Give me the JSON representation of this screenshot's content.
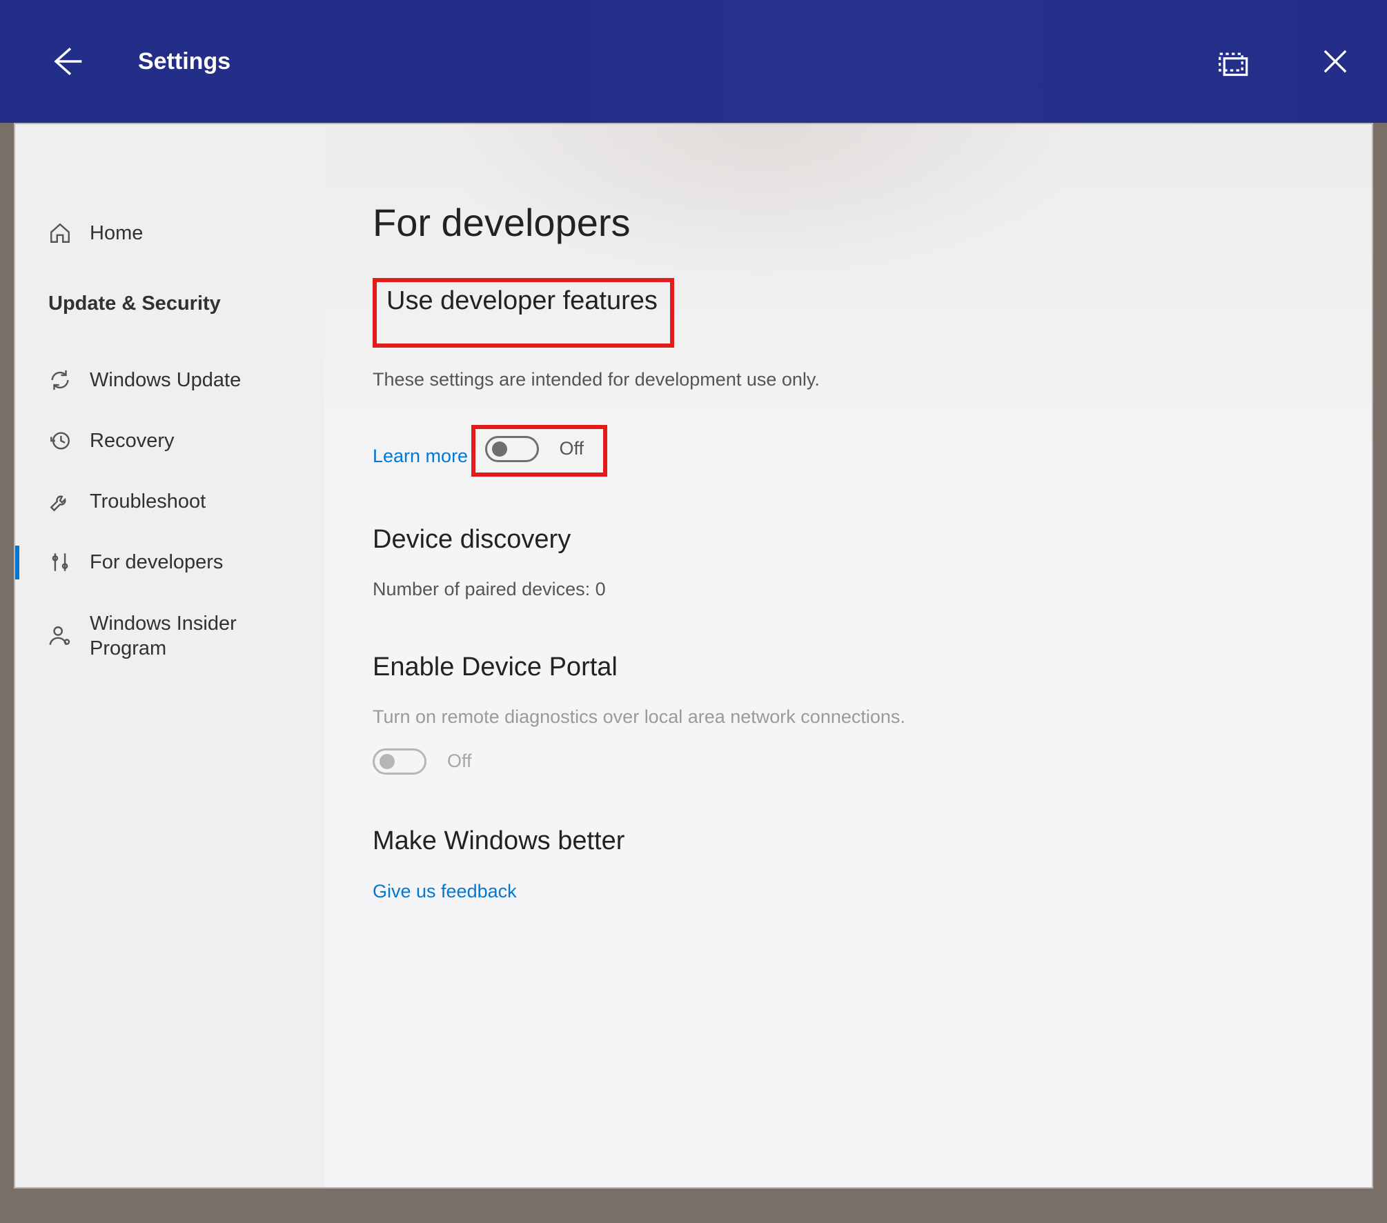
{
  "titlebar": {
    "title": "Settings"
  },
  "sidebar": {
    "home": "Home",
    "category": "Update & Security",
    "items": [
      {
        "icon": "refresh",
        "label": "Windows Update"
      },
      {
        "icon": "history",
        "label": "Recovery"
      },
      {
        "icon": "wrench",
        "label": "Troubleshoot"
      },
      {
        "icon": "sliders",
        "label": "For developers",
        "active": true
      },
      {
        "icon": "person",
        "label": "Windows Insider Program"
      }
    ]
  },
  "page": {
    "title": "For developers",
    "dev_features": {
      "heading": "Use developer features",
      "desc": "These settings are intended for development use only.",
      "learn_more": "Learn more",
      "toggle_label": "Off"
    },
    "discovery": {
      "heading": "Device discovery",
      "paired_label": "Number of paired devices:",
      "paired_count": "0"
    },
    "device_portal": {
      "heading": "Enable Device Portal",
      "desc": "Turn on remote diagnostics over local area network connections.",
      "toggle_label": "Off"
    },
    "make_better": {
      "heading": "Make Windows better",
      "feedback_link": "Give us feedback"
    }
  },
  "colors": {
    "accent": "#0078d4",
    "highlight": "#e21b1b",
    "titlebar": "#2a3490"
  }
}
